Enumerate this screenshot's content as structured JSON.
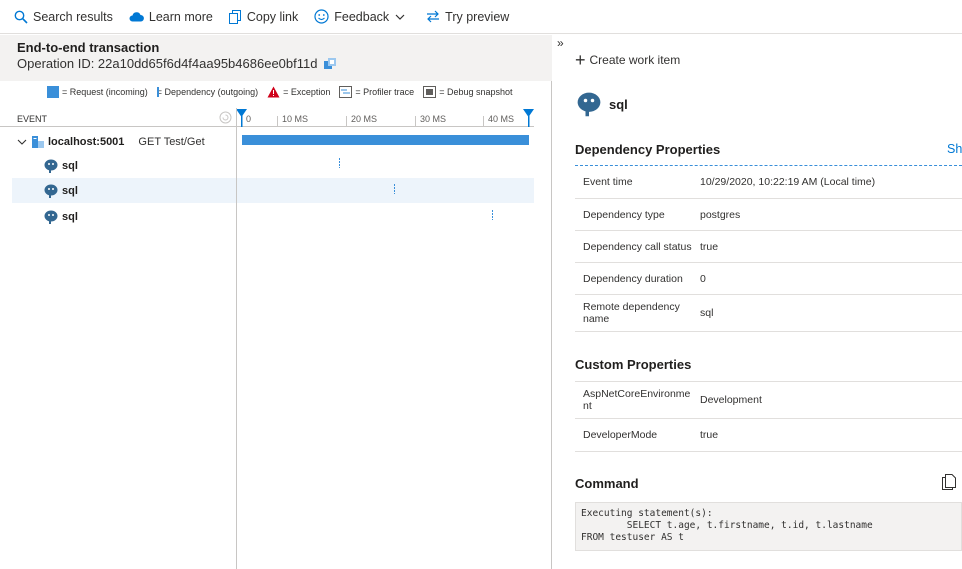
{
  "toolbar": {
    "search_results": "Search results",
    "learn_more": "Learn more",
    "copy_link": "Copy link",
    "feedback": "Feedback",
    "try_preview": "Try preview"
  },
  "transaction": {
    "title": "End-to-end transaction",
    "operation_id": "Operation ID: 22a10dd65f6d4f4aa95b4686ee0bf11d"
  },
  "legend": {
    "request": "= Request (incoming)",
    "dependency": "= Dependency (outgoing)",
    "exception": "= Exception",
    "profiler": "= Profiler trace",
    "debug": "= Debug snapshot"
  },
  "timeline": {
    "event_header": "EVENT",
    "ticks": [
      "0",
      "10 MS",
      "20 MS",
      "30 MS",
      "40 MS"
    ],
    "root": {
      "name": "localhost:5001",
      "operation": "GET Test/Get"
    },
    "children": [
      {
        "name": "sql",
        "selected": false
      },
      {
        "name": "sql",
        "selected": true
      },
      {
        "name": "sql",
        "selected": false
      }
    ]
  },
  "details": {
    "collapse_glyph": "»",
    "create_work_item": "Create work item",
    "title": "sql",
    "show_all_link": "Sh",
    "dependency_section": "Dependency Properties",
    "dependency_props": [
      {
        "key": "Event time",
        "value": "10/29/2020, 10:22:19 AM (Local time)"
      },
      {
        "key": "Dependency type",
        "value": "postgres"
      },
      {
        "key": "Dependency call status",
        "value": "true"
      },
      {
        "key": "Dependency duration",
        "value": "0"
      },
      {
        "key": "Remote dependency name",
        "value": "sql"
      }
    ],
    "custom_section": "Custom Properties",
    "custom_props": [
      {
        "key": "AspNetCoreEnvironme nt",
        "value": "Development"
      },
      {
        "key": "DeveloperMode",
        "value": "true"
      }
    ],
    "command_section": "Command",
    "command_text": "Executing statement(s):\n        SELECT t.age, t.firstname, t.id, t.lastname\nFROM testuser AS t"
  },
  "colors": {
    "accent": "#3a8fd9",
    "link": "#0078d4",
    "header_bg": "#f3f2f1",
    "selected_row": "#edf4fb"
  }
}
